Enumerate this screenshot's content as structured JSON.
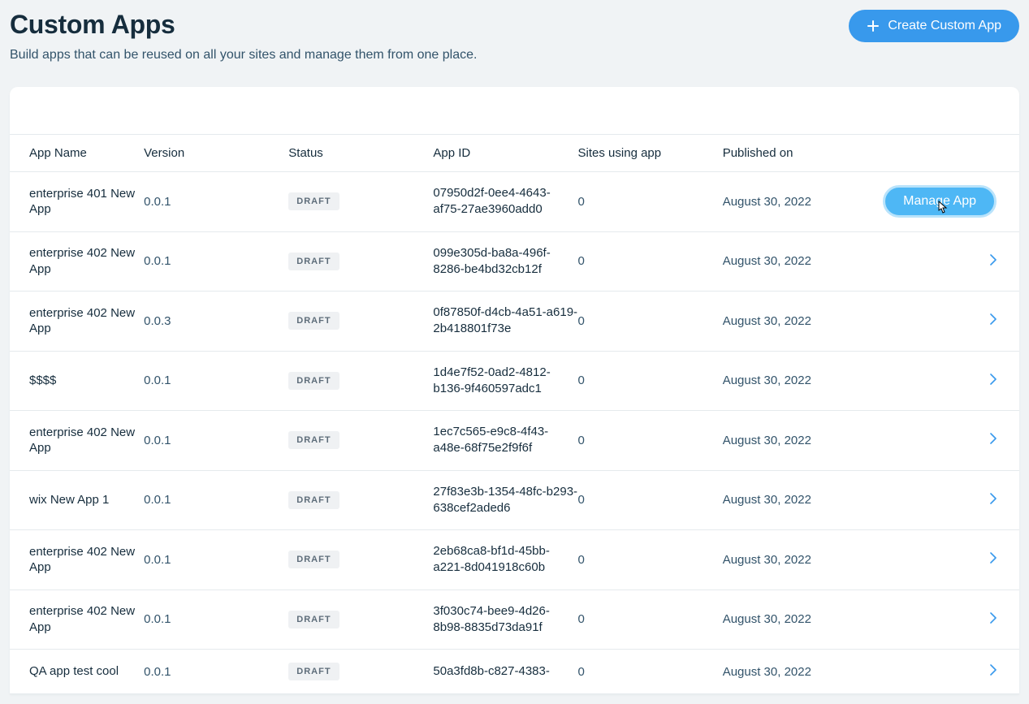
{
  "header": {
    "title": "Custom Apps",
    "subtitle": "Build apps that can be reused on all your sites and manage them from one place.",
    "create_label": "Create Custom App"
  },
  "table": {
    "columns": {
      "name": "App Name",
      "version": "Version",
      "status": "Status",
      "id": "App ID",
      "sites": "Sites using app",
      "published": "Published on"
    },
    "manage_label": "Manage App",
    "rows": [
      {
        "name": "enterprise 401 New App",
        "version": "0.0.1",
        "status": "DRAFT",
        "id": "07950d2f-0ee4-4643-af75-27ae3960add0",
        "sites": "0",
        "published": "August 30, 2022",
        "hovered": true
      },
      {
        "name": "enterprise 402 New App",
        "version": "0.0.1",
        "status": "DRAFT",
        "id": "099e305d-ba8a-496f-8286-be4bd32cb12f",
        "sites": "0",
        "published": "August 30, 2022"
      },
      {
        "name": "enterprise 402 New App",
        "version": "0.0.3",
        "status": "DRAFT",
        "id": "0f87850f-d4cb-4a51-a619-2b418801f73e",
        "sites": "0",
        "published": "August 30, 2022"
      },
      {
        "name": "$$$$",
        "version": "0.0.1",
        "status": "DRAFT",
        "id": "1d4e7f52-0ad2-4812-b136-9f460597adc1",
        "sites": "0",
        "published": "August 30, 2022"
      },
      {
        "name": "enterprise 402 New App",
        "version": "0.0.1",
        "status": "DRAFT",
        "id": "1ec7c565-e9c8-4f43-a48e-68f75e2f9f6f",
        "sites": "0",
        "published": "August 30, 2022"
      },
      {
        "name": "wix New App 1",
        "version": "0.0.1",
        "status": "DRAFT",
        "id": "27f83e3b-1354-48fc-b293-638cef2aded6",
        "sites": "0",
        "published": "August 30, 2022"
      },
      {
        "name": "enterprise 402 New App",
        "version": "0.0.1",
        "status": "DRAFT",
        "id": "2eb68ca8-bf1d-45bb-a221-8d041918c60b",
        "sites": "0",
        "published": "August 30, 2022"
      },
      {
        "name": "enterprise 402 New App",
        "version": "0.0.1",
        "status": "DRAFT",
        "id": "3f030c74-bee9-4d26-8b98-8835d73da91f",
        "sites": "0",
        "published": "August 30, 2022"
      },
      {
        "name": "QA app test cool",
        "version": "0.0.1",
        "status": "DRAFT",
        "id": "50a3fd8b-c827-4383-",
        "sites": "0",
        "published": "August 30, 2022"
      }
    ]
  }
}
